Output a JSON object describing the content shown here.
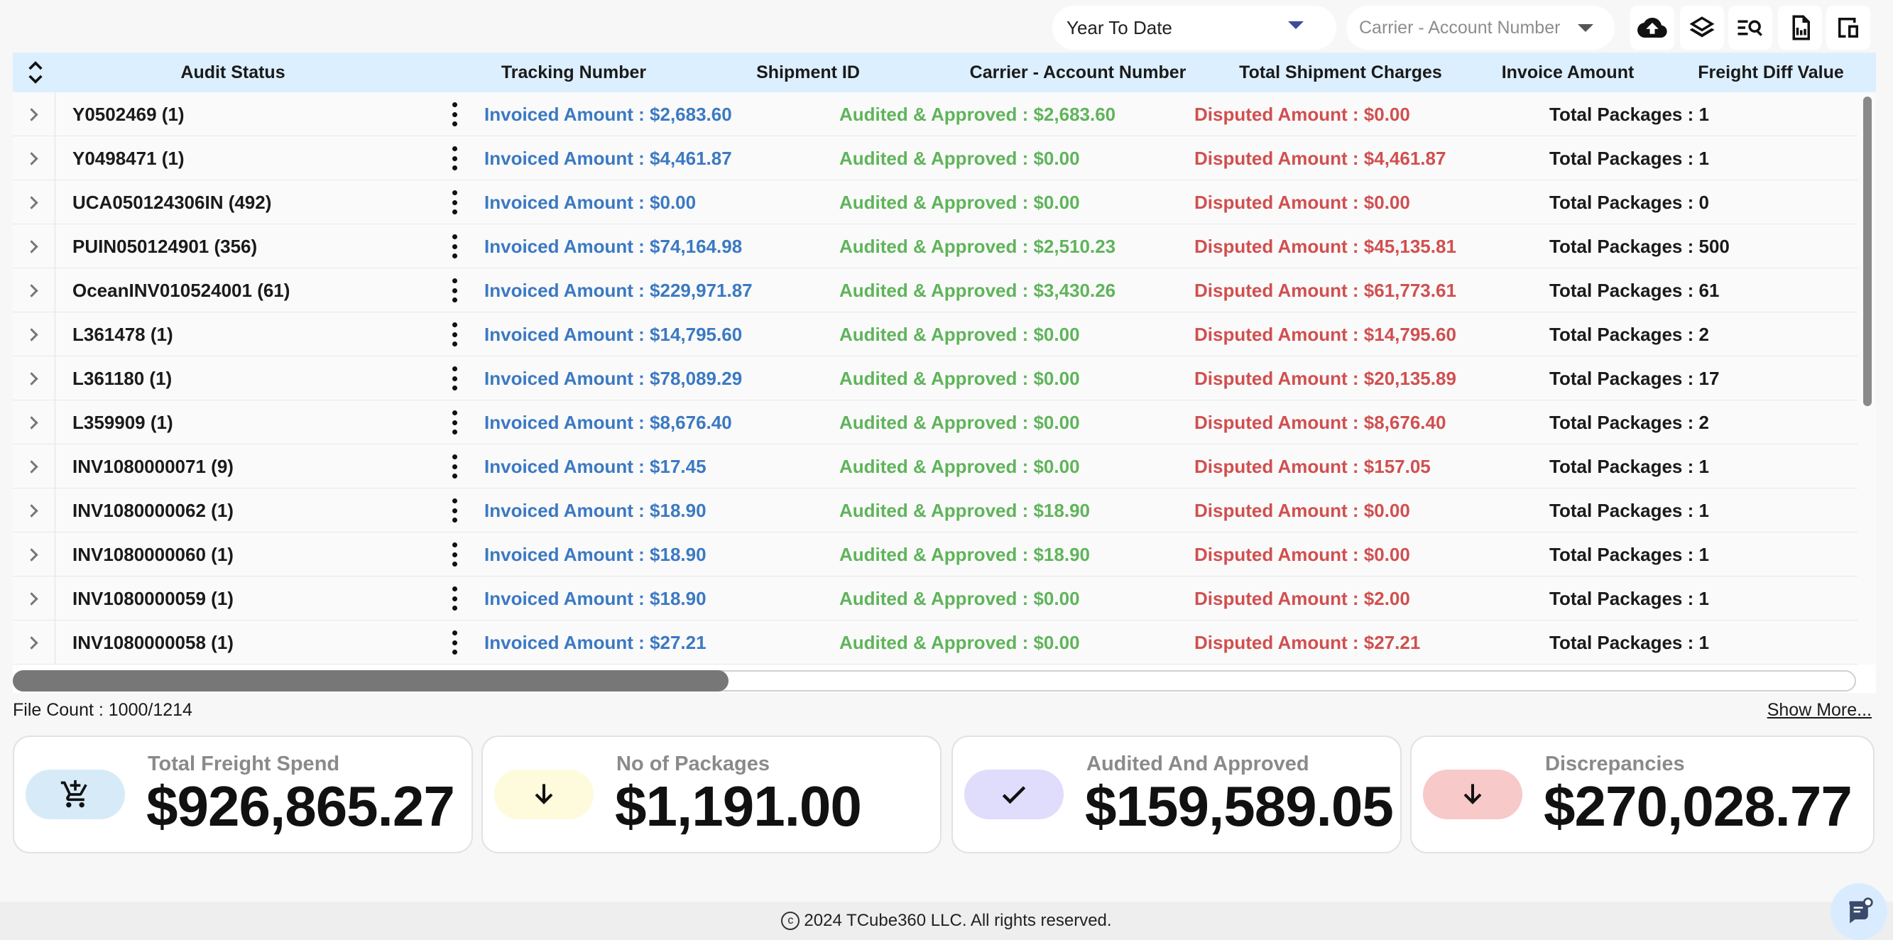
{
  "toolbar": {
    "period_value": "Year To Date",
    "carrier_placeholder": "Carrier - Account Number",
    "buttons": [
      "upload-icon",
      "layers-icon",
      "search-list-icon",
      "export-doc-icon",
      "device-icon"
    ]
  },
  "grid": {
    "columns": [
      "Audit Status",
      "Tracking Number",
      "Shipment ID",
      "Carrier - Account Number",
      "Total Shipment Charges",
      "Invoice Amount",
      "Freight Diff Value"
    ],
    "rows": [
      {
        "name": "Y0502469 (1)",
        "invoiced": "Invoiced Amount : $2,683.60",
        "audited": "Audited & Approved : $2,683.60",
        "disputed": "Disputed Amount : $0.00",
        "packages": "Total Packages : 1"
      },
      {
        "name": "Y0498471 (1)",
        "invoiced": "Invoiced Amount : $4,461.87",
        "audited": "Audited & Approved : $0.00",
        "disputed": "Disputed Amount : $4,461.87",
        "packages": "Total Packages : 1"
      },
      {
        "name": "UCA050124306IN (492)",
        "invoiced": "Invoiced Amount : $0.00",
        "audited": "Audited & Approved : $0.00",
        "disputed": "Disputed Amount : $0.00",
        "packages": "Total Packages : 0"
      },
      {
        "name": "PUIN050124901 (356)",
        "invoiced": "Invoiced Amount : $74,164.98",
        "audited": "Audited & Approved : $2,510.23",
        "disputed": "Disputed Amount : $45,135.81",
        "packages": "Total Packages : 500"
      },
      {
        "name": "OceanINV010524001 (61)",
        "invoiced": "Invoiced Amount : $229,971.87",
        "audited": "Audited & Approved : $3,430.26",
        "disputed": "Disputed Amount : $61,773.61",
        "packages": "Total Packages : 61"
      },
      {
        "name": "L361478 (1)",
        "invoiced": "Invoiced Amount : $14,795.60",
        "audited": "Audited & Approved : $0.00",
        "disputed": "Disputed Amount : $14,795.60",
        "packages": "Total Packages : 2"
      },
      {
        "name": "L361180 (1)",
        "invoiced": "Invoiced Amount : $78,089.29",
        "audited": "Audited & Approved : $0.00",
        "disputed": "Disputed Amount : $20,135.89",
        "packages": "Total Packages : 17"
      },
      {
        "name": "L359909 (1)",
        "invoiced": "Invoiced Amount : $8,676.40",
        "audited": "Audited & Approved : $0.00",
        "disputed": "Disputed Amount : $8,676.40",
        "packages": "Total Packages : 2"
      },
      {
        "name": "INV1080000071 (9)",
        "invoiced": "Invoiced Amount : $17.45",
        "audited": "Audited & Approved : $0.00",
        "disputed": "Disputed Amount : $157.05",
        "packages": "Total Packages : 1"
      },
      {
        "name": "INV1080000062 (1)",
        "invoiced": "Invoiced Amount : $18.90",
        "audited": "Audited & Approved : $18.90",
        "disputed": "Disputed Amount : $0.00",
        "packages": "Total Packages : 1"
      },
      {
        "name": "INV1080000060 (1)",
        "invoiced": "Invoiced Amount : $18.90",
        "audited": "Audited & Approved : $18.90",
        "disputed": "Disputed Amount : $0.00",
        "packages": "Total Packages : 1"
      },
      {
        "name": "INV1080000059 (1)",
        "invoiced": "Invoiced Amount : $18.90",
        "audited": "Audited & Approved : $0.00",
        "disputed": "Disputed Amount : $2.00",
        "packages": "Total Packages : 1"
      },
      {
        "name": "INV1080000058 (1)",
        "invoiced": "Invoiced Amount : $27.21",
        "audited": "Audited & Approved : $0.00",
        "disputed": "Disputed Amount : $27.21",
        "packages": "Total Packages : 1"
      }
    ],
    "colors": {
      "header_bg": "#dcefff",
      "invoiced": "#3b79c2",
      "audited": "#5fb45a",
      "disputed": "#d14f4f"
    }
  },
  "footer_info": {
    "file_count": "File Count : 1000/1214",
    "show_more": "Show More..."
  },
  "kpis": [
    {
      "title": "Total Freight Spend",
      "value": "$926,865.27",
      "icon": "cart-add-icon",
      "color": "#d6ebf7"
    },
    {
      "title": "No of Packages",
      "value": "$1,191.00",
      "icon": "arrow-down-icon",
      "color": "#fdfbdc"
    },
    {
      "title": "Audited And Approved",
      "value": "$159,589.05",
      "icon": "check-icon",
      "color": "#e0dcfb"
    },
    {
      "title": "Discrepancies",
      "value": "$270,028.77",
      "icon": "arrow-down-icon",
      "color": "#f7c9c9"
    }
  ],
  "footer": {
    "copyright_symbol": "c",
    "copyright": "2024 TCube360 LLC. All rights reserved.",
    "chat_icon": "chat-icon"
  }
}
